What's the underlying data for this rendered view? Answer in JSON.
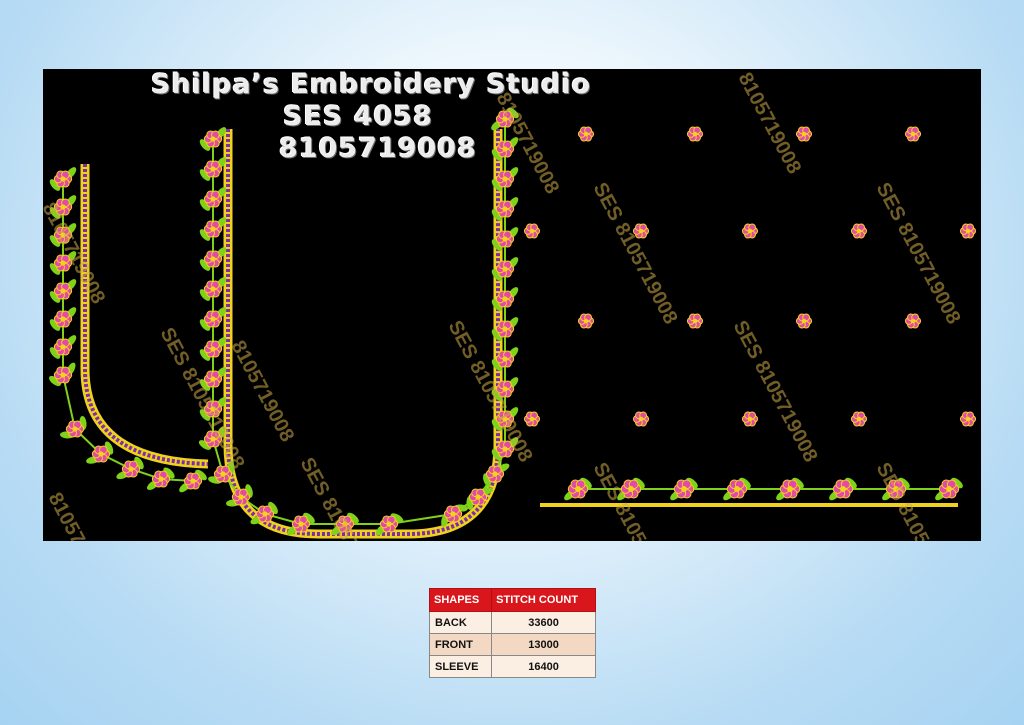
{
  "header": {
    "studio_name": "Shilpa’s Embroidery Studio",
    "design_code": "SES 4058",
    "phone": "8105719008"
  },
  "watermark": {
    "text": "SES 8105719008",
    "digits": "8105719008"
  },
  "colors": {
    "background_gradient_light": "#ffffff",
    "background_gradient_dark": "#a6d3f2",
    "canvas": "#000000",
    "flower_petal": "#e24aa8",
    "flower_center": "#f4d21a",
    "leaf": "#7fd11a",
    "border_gold": "#f0d21c",
    "border_purple": "#7b2ea8",
    "table_header": "#d9161b"
  },
  "table": {
    "headers": [
      "SHAPES",
      "STITCH COUNT"
    ],
    "rows": [
      {
        "shape": "BACK",
        "count": "33600"
      },
      {
        "shape": "FRONT",
        "count": "13000"
      },
      {
        "shape": "SLEEVE",
        "count": "16400"
      }
    ]
  }
}
